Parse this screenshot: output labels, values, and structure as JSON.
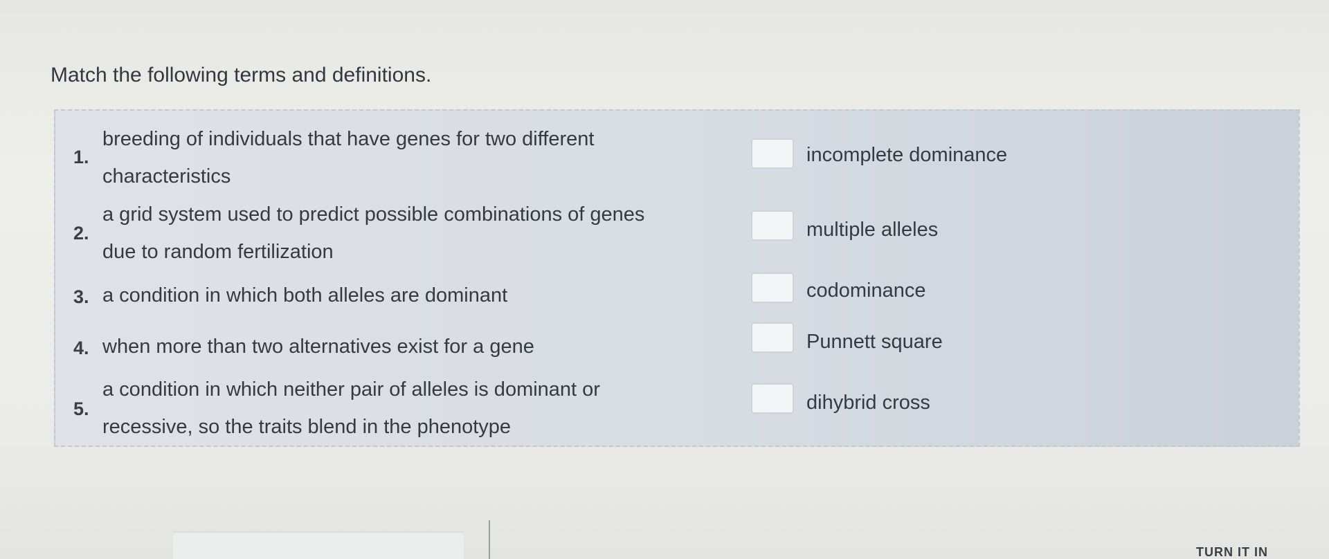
{
  "prompt": "Match the following terms and definitions.",
  "definitions": [
    {
      "number": "1.",
      "line1": "breeding of individuals that have genes for two different",
      "line2": "characteristics"
    },
    {
      "number": "2.",
      "line1": "a grid system used to predict possible combinations of genes",
      "line2": "due to random fertilization"
    },
    {
      "number": "3.",
      "line1": "a condition in which both alleles are dominant",
      "line2": ""
    },
    {
      "number": "4.",
      "line1": "when more than two alternatives exist for a gene",
      "line2": ""
    },
    {
      "number": "5.",
      "line1": "a condition in which neither pair of alleles is dominant or",
      "line2": "recessive, so the traits blend in the phenotype"
    }
  ],
  "answer_boxes": [
    "",
    "",
    "",
    "",
    ""
  ],
  "terms": [
    "incomplete dominance",
    "multiple alleles",
    "codominance",
    "Punnett square",
    "dihybrid cross"
  ],
  "footer": {
    "turn_in_label": "TURN IT IN"
  }
}
